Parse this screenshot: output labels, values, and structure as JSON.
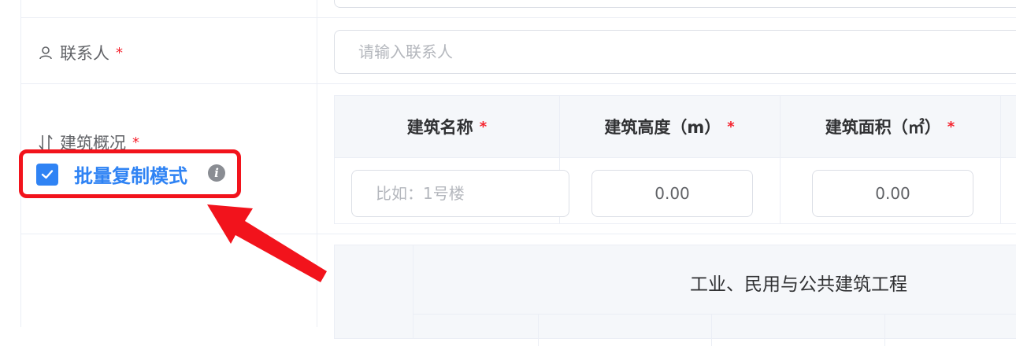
{
  "form": {
    "contact": {
      "label": "联系人",
      "required_mark": "*",
      "icon": "user-icon",
      "placeholder": "请输入联系人",
      "value": ""
    },
    "building": {
      "label": "建筑概况",
      "required_mark": "*",
      "icon": "sort-icon",
      "batch_copy": {
        "label": "批量复制模式",
        "checked": true,
        "info_icon": "info-icon"
      },
      "table": {
        "headers": [
          {
            "label": "建筑名称",
            "required_mark": "*"
          },
          {
            "label": "建筑高度（m）",
            "required_mark": "*"
          },
          {
            "label": "建筑面积（㎡）",
            "required_mark": "*"
          }
        ],
        "row": {
          "name_placeholder": "比如：1号楼",
          "height_value": "0.00",
          "area_value": "0.00"
        }
      }
    },
    "project_table": {
      "title": "工业、民用与公共建筑工程"
    }
  },
  "colors": {
    "accent": "#2f83f4",
    "required": "#f5222d",
    "highlight": "#f2131c"
  }
}
